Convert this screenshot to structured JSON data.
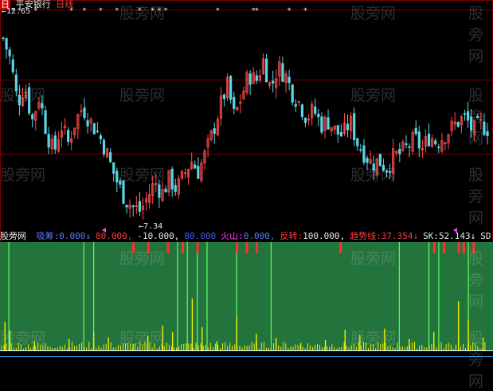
{
  "header": {
    "icon_label": "日",
    "stock_name": "平安银行",
    "period": "日线",
    "high_price": "12.65"
  },
  "colors": {
    "up": "#ff4d4d",
    "down": "#5cd6e6",
    "panel_bg": "#23743c",
    "signal_green": "#5bff5b",
    "signal_red": "#ff3030",
    "volume_yellow": "#f0f000"
  },
  "watermark": "股旁网",
  "indicator": {
    "name": "股旁网",
    "items": [
      {
        "label": "吸筹:",
        "value": "0.000↓",
        "label_color": "#5b7cff",
        "value_color": "#5b7cff"
      },
      {
        "label": "",
        "value": "80.000,",
        "label_color": "#ff3b3b",
        "value_color": "#ff3b3b"
      },
      {
        "label": "",
        "value": "-10.000,",
        "label_color": "#e8e8e8",
        "value_color": "#e8e8e8"
      },
      {
        "label": "",
        "value": "80.000",
        "label_color": "#3b5bff",
        "value_color": "#3b5bff"
      },
      {
        "label": "火山:",
        "value": "0.000,",
        "label_color": "#ff40ff",
        "value_color": "#5b7cff"
      },
      {
        "label": "反转:",
        "value": "100.000,",
        "label_color": "#ff3b3b",
        "value_color": "#e8e8e8"
      },
      {
        "label": "趋势线:",
        "value": "37.354↓",
        "label_color": "#ff3b3b",
        "value_color": "#ff3b3b"
      },
      {
        "label": "SK:",
        "value": "52.143↓",
        "label_color": "#e8e8e8",
        "value_color": "#e8e8e8"
      },
      {
        "label": "SD",
        "value": "",
        "label_color": "#e8e8e8",
        "value_color": "#e8e8e8"
      }
    ]
  },
  "chart_data": {
    "type": "candlestick",
    "price_high_label": "12.65",
    "price_low_label": "7.34",
    "price_range": [
      7.0,
      13.0
    ],
    "close_path": [
      12.2,
      11.6,
      10.4,
      10.9,
      9.9,
      10.6,
      9.6,
      9.0,
      9.8,
      9.3,
      9.9,
      10.3,
      9.9,
      9.6,
      9.2,
      8.6,
      8.1,
      7.7,
      7.5,
      7.4,
      7.8,
      8.2,
      7.9,
      8.3,
      8.0,
      8.4,
      8.8,
      8.5,
      9.0,
      9.6,
      10.3,
      10.9,
      10.0,
      10.6,
      11.2,
      11.0,
      11.6,
      10.8,
      11.4,
      11.2,
      10.7,
      10.4,
      10.0,
      10.2,
      9.8,
      9.9,
      9.6,
      9.5,
      9.9,
      9.3,
      9.0,
      8.7,
      8.8,
      8.6,
      8.9,
      9.0,
      9.2,
      9.4,
      9.1,
      9.5,
      9.3,
      9.5,
      9.7,
      9.9,
      10.0,
      9.6,
      9.8,
      9.7
    ],
    "star_markers": [
      3,
      5,
      10,
      21,
      25,
      30,
      35,
      42,
      46,
      48,
      50,
      66,
      77,
      78,
      88,
      93
    ],
    "signal_ticks": [
      {
        "x": 0.27,
        "color": "red"
      },
      {
        "x": 0.3,
        "color": "red"
      },
      {
        "x": 0.34,
        "color": "red"
      },
      {
        "x": 0.37,
        "color": "red"
      },
      {
        "x": 0.4,
        "color": "red"
      },
      {
        "x": 0.48,
        "color": "red"
      },
      {
        "x": 0.5,
        "color": "red"
      },
      {
        "x": 0.52,
        "color": "red"
      },
      {
        "x": 0.69,
        "color": "red"
      },
      {
        "x": 0.88,
        "color": "red"
      },
      {
        "x": 0.9,
        "color": "red"
      },
      {
        "x": 0.93,
        "color": "red"
      },
      {
        "x": 0.94,
        "color": "red"
      },
      {
        "x": 0.96,
        "color": "red"
      }
    ],
    "green_signals": [
      0.018,
      0.17,
      0.19,
      0.36,
      0.38,
      0.4,
      0.42,
      0.48,
      0.55,
      0.81,
      0.87,
      0.89,
      0.95
    ],
    "volume_spikes": [
      {
        "x": 0.01,
        "v": 0.55
      },
      {
        "x": 0.02,
        "v": 0.38
      },
      {
        "x": 0.07,
        "v": 0.18
      },
      {
        "x": 0.14,
        "v": 0.22
      },
      {
        "x": 0.19,
        "v": 0.35
      },
      {
        "x": 0.22,
        "v": 0.25
      },
      {
        "x": 0.27,
        "v": 0.12
      },
      {
        "x": 0.3,
        "v": 0.28
      },
      {
        "x": 0.33,
        "v": 0.48
      },
      {
        "x": 0.35,
        "v": 0.35
      },
      {
        "x": 0.39,
        "v": 1.0
      },
      {
        "x": 0.41,
        "v": 0.45
      },
      {
        "x": 0.44,
        "v": 0.18
      },
      {
        "x": 0.48,
        "v": 0.65
      },
      {
        "x": 0.52,
        "v": 0.32
      },
      {
        "x": 0.56,
        "v": 0.24
      },
      {
        "x": 0.61,
        "v": 0.14
      },
      {
        "x": 0.66,
        "v": 0.2
      },
      {
        "x": 0.7,
        "v": 0.4
      },
      {
        "x": 0.73,
        "v": 0.3
      },
      {
        "x": 0.78,
        "v": 0.42
      },
      {
        "x": 0.83,
        "v": 0.22
      },
      {
        "x": 0.88,
        "v": 0.35
      },
      {
        "x": 0.93,
        "v": 0.95
      },
      {
        "x": 0.95,
        "v": 0.6
      },
      {
        "x": 0.98,
        "v": 0.25
      }
    ]
  }
}
